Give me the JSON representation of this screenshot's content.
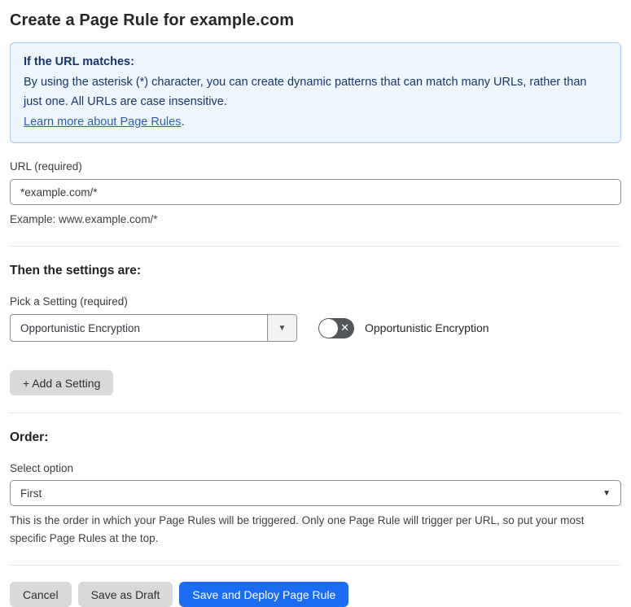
{
  "page": {
    "title": "Create a Page Rule for example.com"
  },
  "info_box": {
    "heading": "If the URL matches:",
    "body": "By using the asterisk (*) character, you can create dynamic patterns that can match many URLs, rather than just one. All URLs are case insensitive.",
    "link_label": "Learn more about Page Rules",
    "link_suffix": "."
  },
  "url_field": {
    "label": "URL (required)",
    "value": "*example.com/*",
    "helper": "Example: www.example.com/*"
  },
  "settings_section": {
    "heading": "Then the settings are:",
    "picker_label": "Pick a Setting (required)",
    "picker_value": "Opportunistic Encryption",
    "toggle_state": "off",
    "toggle_glyph": "✕",
    "toggle_label": "Opportunistic Encryption",
    "add_button_label": "+ Add a Setting"
  },
  "order_section": {
    "heading": "Order:",
    "select_label": "Select option",
    "select_value": "First",
    "helper": "This is the order in which your Page Rules will be triggered. Only one Page Rule will trigger per URL, so put your most specific Page Rules at the top."
  },
  "footer": {
    "cancel_label": "Cancel",
    "save_draft_label": "Save as Draft",
    "save_deploy_label": "Save and Deploy Page Rule"
  },
  "icons": {
    "dropdown_arrow": "▼"
  },
  "colors": {
    "accent_blue": "#1a6df2",
    "info_bg": "#edf5fd",
    "info_border": "#a9c9ee",
    "info_text": "#17376b",
    "link_blue": "#2c5fb3",
    "button_gray": "#d9d9d9",
    "toggle_off_gray": "#52555a"
  }
}
